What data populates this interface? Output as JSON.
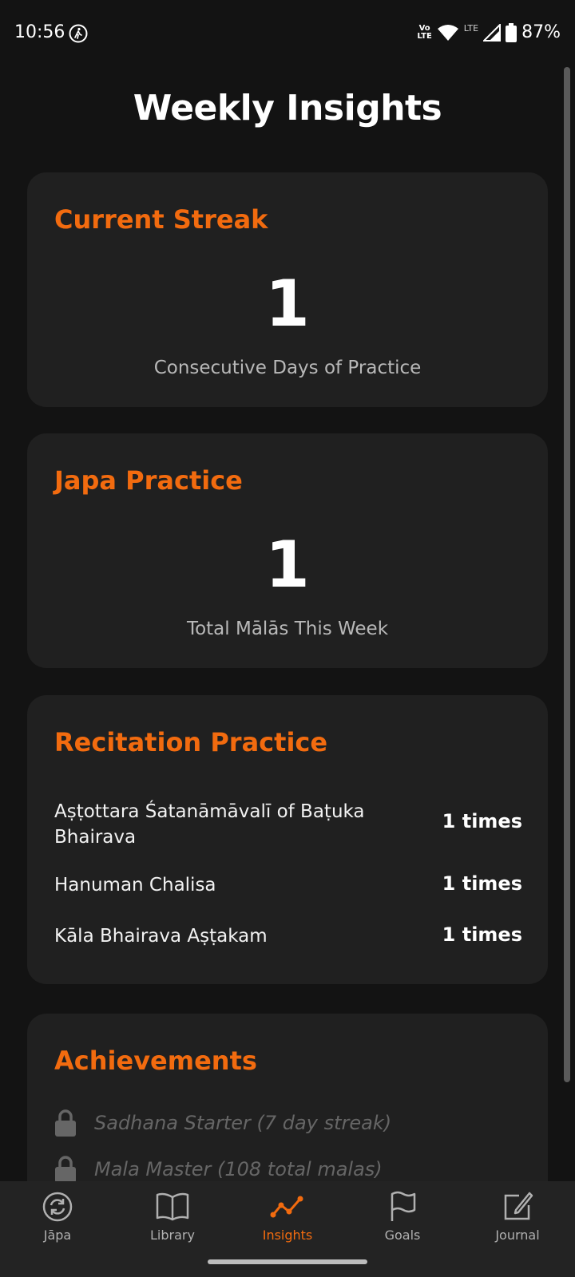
{
  "status": {
    "time": "10:56",
    "battery": "87%",
    "volte_top": "Vo",
    "volte_bottom": "LTE",
    "lte": "LTE"
  },
  "page": {
    "title": "Weekly Insights"
  },
  "streak": {
    "title": "Current Streak",
    "value": "1",
    "caption": "Consecutive Days of Practice"
  },
  "japa": {
    "title": "Japa Practice",
    "value": "1",
    "caption": "Total Mālās This Week"
  },
  "recitation": {
    "title": "Recitation Practice",
    "items": [
      {
        "name": "Aṣṭottara Śatanāmāvalī of Baṭuka Bhairava",
        "count": "1 times"
      },
      {
        "name": "Hanuman Chalisa",
        "count": "1 times"
      },
      {
        "name": "Kāla Bhairava Aṣṭakam",
        "count": "1 times"
      }
    ]
  },
  "achievements": {
    "title": "Achievements",
    "items": [
      {
        "label": "Sadhana Starter (7 day streak)",
        "locked": true
      },
      {
        "label": "Mala Master (108 total malas)",
        "locked": true
      }
    ]
  },
  "nav": {
    "items": [
      {
        "label": "Jāpa",
        "icon": "refresh-circle-icon"
      },
      {
        "label": "Library",
        "icon": "book-icon"
      },
      {
        "label": "Insights",
        "icon": "trend-icon",
        "active": true
      },
      {
        "label": "Goals",
        "icon": "flag-icon"
      },
      {
        "label": "Journal",
        "icon": "edit-icon"
      }
    ]
  },
  "colors": {
    "accent": "#f26b0f",
    "background": "#131313",
    "card": "#202020"
  }
}
